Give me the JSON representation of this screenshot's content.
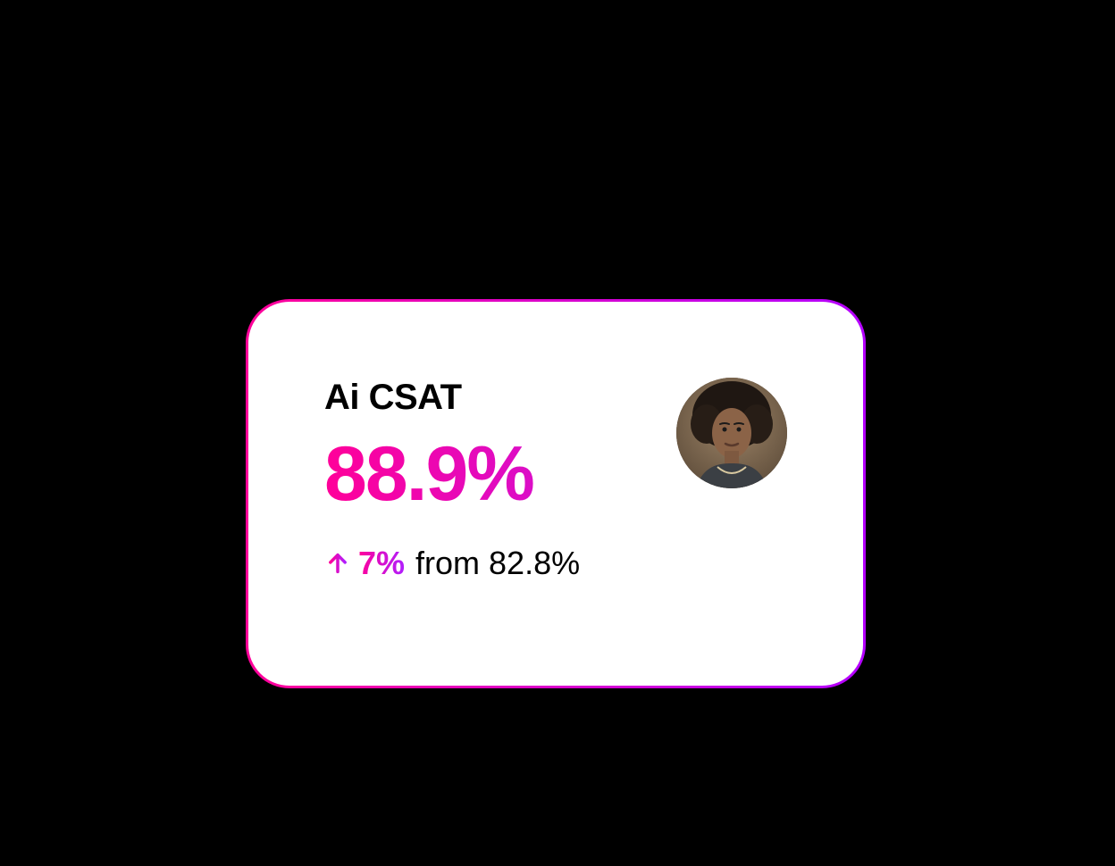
{
  "card": {
    "title": "Ai CSAT",
    "value": "88.9%",
    "change": {
      "direction": "up",
      "delta": "7%",
      "from_label": "from 82.8%"
    },
    "colors": {
      "gradient_start": "#ff0099",
      "gradient_end": "#b01eff",
      "text": "#000000",
      "card_bg": "#ffffff",
      "page_bg": "#000000"
    }
  }
}
